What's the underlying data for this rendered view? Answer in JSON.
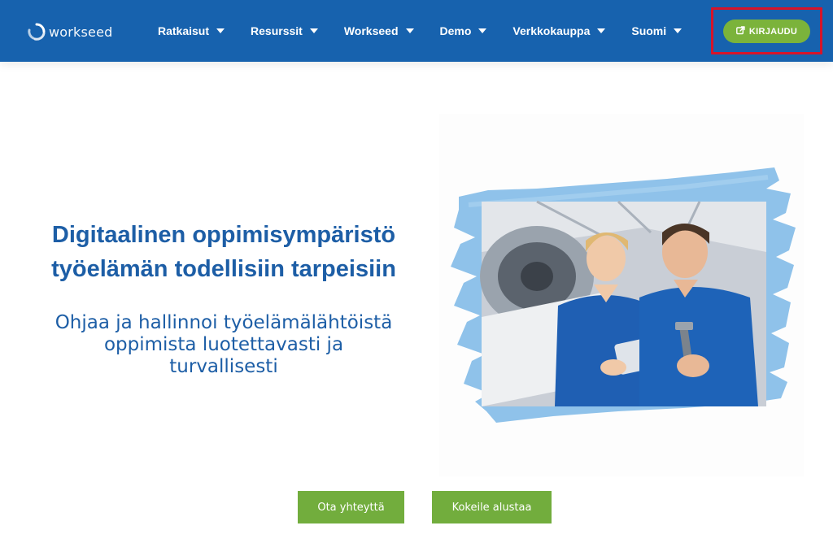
{
  "header": {
    "logo_text": "workseed",
    "nav": [
      {
        "label": "Ratkaisut"
      },
      {
        "label": "Resurssit"
      },
      {
        "label": "Workseed"
      },
      {
        "label": "Demo"
      },
      {
        "label": "Verkkokauppa"
      },
      {
        "label": "Suomi"
      }
    ],
    "login_label": "KIRJAUDU"
  },
  "hero": {
    "title_line1": "Digitaalinen oppimisympäristö",
    "title_line2": "työelämän todellisiin tarpeisiin",
    "subtitle_line1": "Ohjaa ja hallinnoi työelämälähtöistä",
    "subtitle_line2": "oppimista luotettavasti ja",
    "subtitle_line3": "turvallisesti"
  },
  "cta": {
    "contact_label": "Ota yhteyttä",
    "try_label": "Kokeile alustaa"
  },
  "icons": {
    "logo": "workseed-logo-icon",
    "login": "external-link-icon",
    "dropdown": "caret-down-icon"
  },
  "colors": {
    "header_bg": "#1762ae",
    "brand_text": "#1d5ea6",
    "accent_green": "#72ad3d",
    "highlight_red": "#d6142a",
    "brush_blue": "#8fc2ea"
  }
}
